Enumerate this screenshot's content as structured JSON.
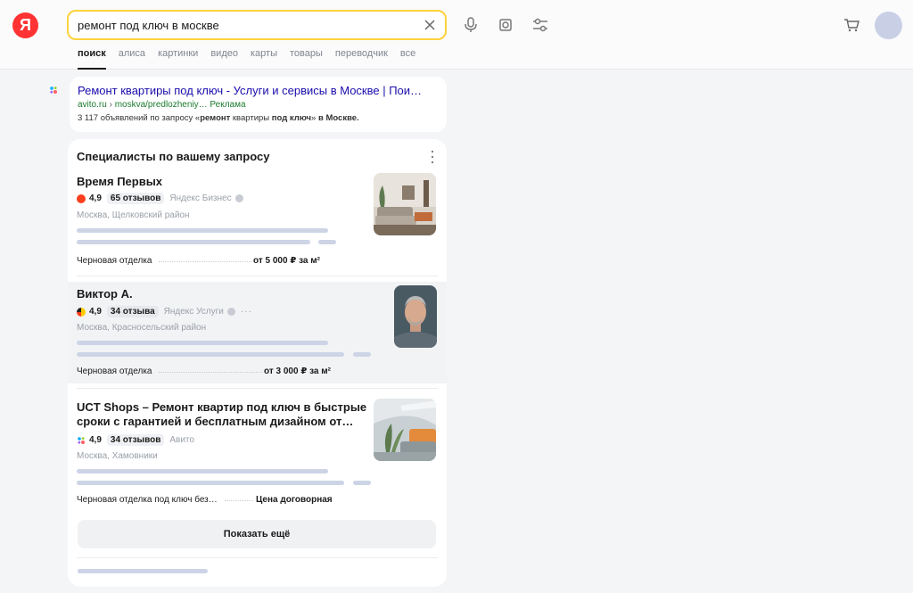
{
  "search": {
    "query": "ремонт под ключ в москве"
  },
  "tabs": [
    {
      "label": "поиск",
      "active": true
    },
    {
      "label": "алиса"
    },
    {
      "label": "картинки"
    },
    {
      "label": "видео"
    },
    {
      "label": "карты"
    },
    {
      "label": "товары"
    },
    {
      "label": "переводчик"
    },
    {
      "label": "все"
    }
  ],
  "ad": {
    "title": "Ремонт квартиры под ключ - Услуги и сервисы в Москве | Пои…",
    "domain": "avito.ru",
    "separator": "›",
    "path": "moskva/predlozheniy…",
    "label": "Реклама",
    "desc_prefix": "3 117 объявлений по запросу «",
    "desc_bold1": "ремонт",
    "desc_mid1": " квартиры ",
    "desc_bold2": "под ключ",
    "desc_mid2": "» ",
    "desc_bold3": "в Москве."
  },
  "specialists": {
    "title": "Специалисты по вашему запросу",
    "items": [
      {
        "name": "Время Первых",
        "rating": "4,9",
        "reviews": "65 отзывов",
        "source": "Яндекс Бизнес",
        "location": "Москва, Щелковский район",
        "service": "Черновая отделка",
        "price": "от 5 000 ₽ за м²"
      },
      {
        "name": "Виктор А.",
        "rating": "4,9",
        "reviews": "34 отзыва",
        "source": "Яндекс Услуги",
        "location": "Москва, Красносельский район",
        "service": "Черновая отделка",
        "price": "от 3 000 ₽ за м²"
      },
      {
        "name_line1": "UCT Shops – Ремонт квартир под ключ в быстрые",
        "name_line2": "сроки  с гарантией и бесплатным дизайном от…",
        "rating": "4,9",
        "reviews": "34 отзывов",
        "source": "Авито",
        "location": "Москва, Хамовники",
        "service": "Черновая отделка под ключ без…",
        "price": "Цена договорная"
      }
    ],
    "more_label": "Показать ещё"
  },
  "logo_letter": "Я",
  "colors": {
    "accent_yellow": "#ffd23a",
    "logo_red": "#ff3333",
    "link_blue": "#1a0dab",
    "url_green": "#1c7c2f"
  }
}
